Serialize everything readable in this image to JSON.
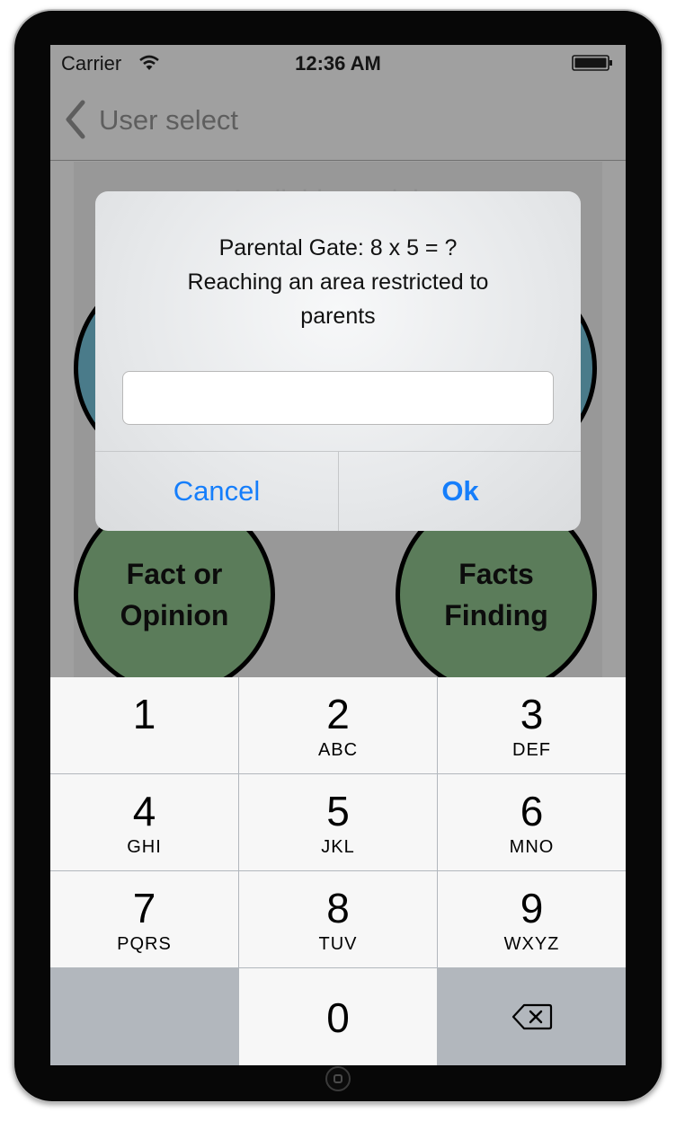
{
  "status_bar": {
    "carrier": "Carrier",
    "time": "12:36 AM"
  },
  "nav": {
    "back_label": "User select"
  },
  "content": {
    "title": "Available modules",
    "modules": [
      {
        "label": ""
      },
      {
        "label": ""
      },
      {
        "label": "Fact or\nOpinion"
      },
      {
        "label": "Facts\nFinding"
      }
    ]
  },
  "alert": {
    "message": "Parental Gate: 8 x 5 = ?\nReaching an area restricted to parents",
    "line1": "Parental Gate: 8 x 5 = ?",
    "line2": "Reaching an area restricted to",
    "line3": "parents",
    "input_value": "",
    "cancel_label": "Cancel",
    "ok_label": "Ok"
  },
  "keypad": {
    "keys": [
      {
        "num": "1",
        "letters": ""
      },
      {
        "num": "2",
        "letters": "ABC"
      },
      {
        "num": "3",
        "letters": "DEF"
      },
      {
        "num": "4",
        "letters": "GHI"
      },
      {
        "num": "5",
        "letters": "JKL"
      },
      {
        "num": "6",
        "letters": "MNO"
      },
      {
        "num": "7",
        "letters": "PQRS"
      },
      {
        "num": "8",
        "letters": "TUV"
      },
      {
        "num": "9",
        "letters": "WXYZ"
      },
      {
        "num": "0",
        "letters": ""
      }
    ],
    "delete_icon": "delete-backspace-icon"
  },
  "colors": {
    "accent": "#157efb",
    "module_green": "#5b7c5a",
    "module_blue": "#4a7b8a"
  }
}
